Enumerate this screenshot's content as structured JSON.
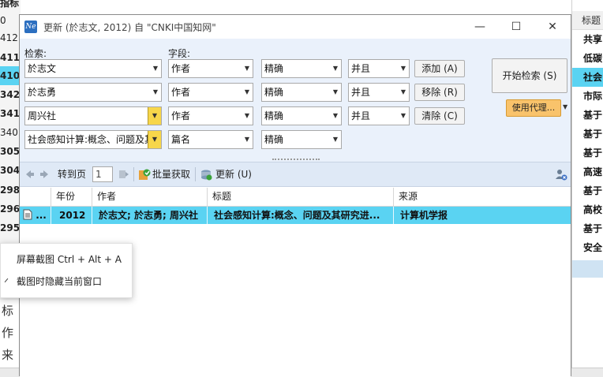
{
  "background": {
    "left_fragments": [
      "指标",
      "0",
      "412",
      "411",
      "410",
      "342",
      "341",
      "340",
      "305",
      "304",
      "298",
      "296",
      "295"
    ],
    "right_header": "标题",
    "right_rows": [
      "共享",
      "低碳",
      "社会",
      "市际",
      "基于",
      "基于",
      "基于",
      "高速",
      "基于",
      "高校",
      "基于",
      "安全"
    ],
    "bottom_left": [
      "标题",
      "作者",
      "来源"
    ]
  },
  "window": {
    "icon_label": "Ne",
    "title": "更新 (於志文, 2012) 自 \"CNKI中国知网\"",
    "minimize": "—",
    "maximize": "☐",
    "close": "✕"
  },
  "search": {
    "search_label": "检索:",
    "field_label": "字段:",
    "rows": [
      {
        "term": "於志文",
        "field": "作者",
        "match": "精确",
        "logic": "并且"
      },
      {
        "term": "於志勇",
        "field": "作者",
        "match": "精确",
        "logic": "并且"
      },
      {
        "term": "周兴社",
        "field": "作者",
        "match": "精确",
        "logic": "并且"
      },
      {
        "term": "社会感知计算:概念、问题及其",
        "field": "篇名",
        "match": "精确",
        "logic": ""
      }
    ],
    "add_button": "添加 (A)",
    "remove_button": "移除 (R)",
    "clear_button": "清除 (C)",
    "start_button": "开始检索 (S)",
    "proxy_button": "使用代理..."
  },
  "toolbar": {
    "goto_label": "转到页",
    "page_value": "1",
    "batch_label": "批量获取",
    "update_label": "更新 (U)"
  },
  "results": {
    "columns": [
      "年份",
      "作者",
      "标题",
      "来源"
    ],
    "rows": [
      {
        "icon": "...",
        "year": "2012",
        "authors": "於志文; 於志勇; 周兴社",
        "title": "社会感知计算:概念、问题及其研究进...",
        "source": "计算机学报"
      }
    ]
  },
  "context_menu": {
    "items": [
      "屏幕截图 Ctrl + Alt + A",
      "截图时隐藏当前窗口"
    ]
  },
  "colors": {
    "selection": "#5ad3f2",
    "search_bg": "#eaf1fb",
    "toolbar_bg": "#dfe9f6",
    "proxy_button": "#f9c36b"
  }
}
